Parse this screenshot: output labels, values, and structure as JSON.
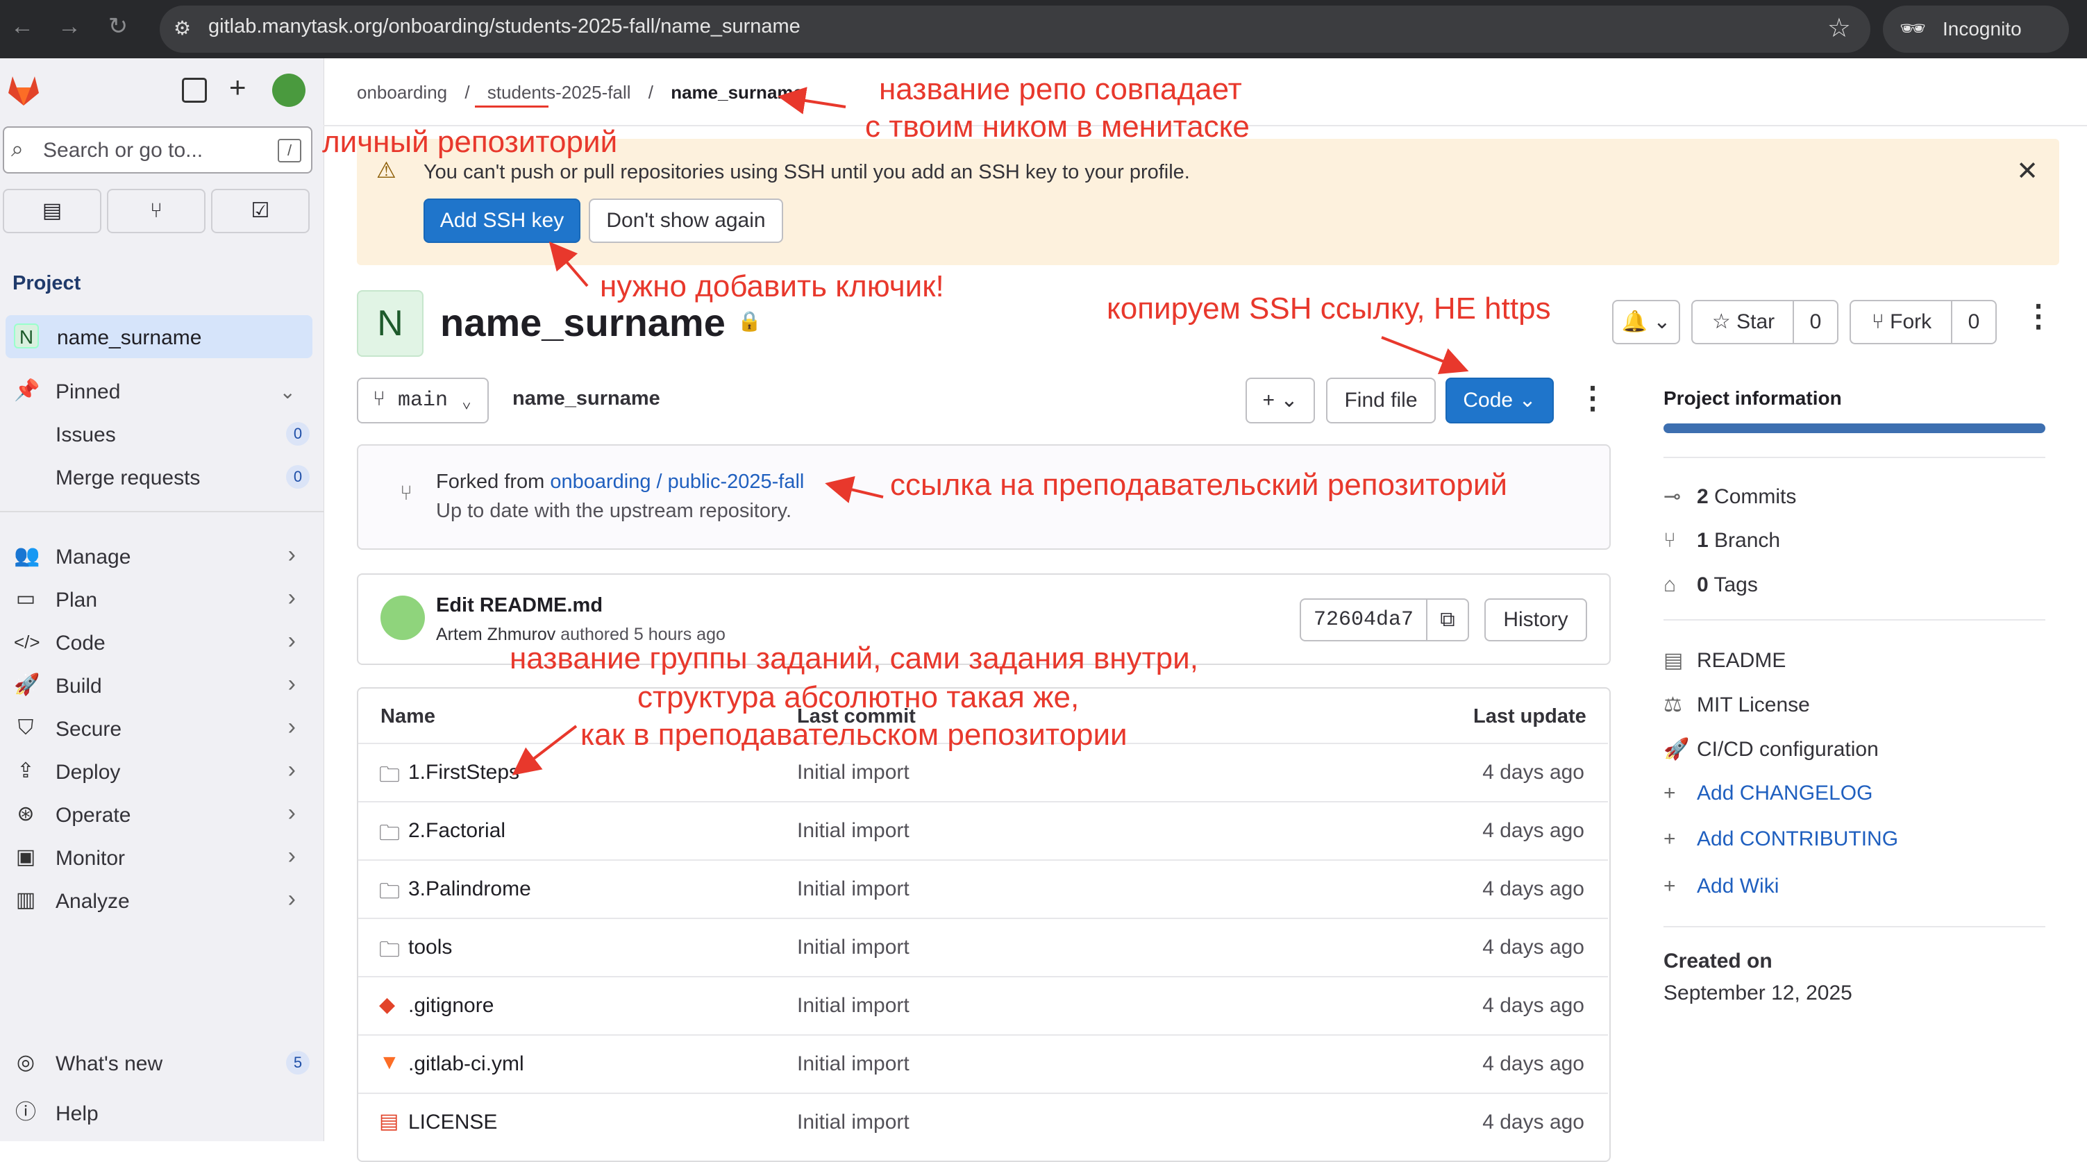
{
  "browser": {
    "url": "gitlab.manytask.org/onboarding/students-2025-fall/name_surname",
    "incognito_label": "Incognito"
  },
  "sidebar": {
    "search_placeholder": "Search or go to...",
    "search_shortcut": "/",
    "section_title": "Project",
    "project_avatar": "N",
    "project_name": "name_surname",
    "pinned_label": "Pinned",
    "pinned_items": [
      {
        "label": "Issues",
        "count": "0"
      },
      {
        "label": "Merge requests",
        "count": "0"
      }
    ],
    "nav": [
      {
        "label": "Manage",
        "icon": "manage-icon"
      },
      {
        "label": "Plan",
        "icon": "plan-icon"
      },
      {
        "label": "Code",
        "icon": "code-icon"
      },
      {
        "label": "Build",
        "icon": "rocket-icon"
      },
      {
        "label": "Secure",
        "icon": "shield-icon"
      },
      {
        "label": "Deploy",
        "icon": "deploy-icon"
      },
      {
        "label": "Operate",
        "icon": "operate-icon"
      },
      {
        "label": "Monitor",
        "icon": "monitor-icon"
      },
      {
        "label": "Analyze",
        "icon": "chart-icon"
      }
    ],
    "whats_new": {
      "label": "What's new",
      "count": "5"
    },
    "help_label": "Help"
  },
  "breadcrumb": [
    "onboarding",
    "students-2025-fall",
    "name_surname"
  ],
  "alert": {
    "text": "You can't push or pull repositories using SSH until you add an SSH key to your profile.",
    "primary_button": "Add SSH key",
    "secondary_button": "Don't show again"
  },
  "project": {
    "avatar": "N",
    "title": "name_surname",
    "star_label": "Star",
    "star_count": "0",
    "fork_label": "Fork",
    "fork_count": "0"
  },
  "toolbar": {
    "branch": "main",
    "path": "name_surname",
    "find_file": "Find file",
    "code_button": "Code"
  },
  "fork_info": {
    "prefix": "Forked from ",
    "source": "onboarding / public-2025-fall",
    "status": "Up to date with the upstream repository."
  },
  "last_commit": {
    "title": "Edit README.md",
    "author": "Artem Zhmurov",
    "meta": " authored 5 hours ago",
    "sha": "72604da7",
    "history_button": "History"
  },
  "file_table": {
    "headers": {
      "name": "Name",
      "commit": "Last commit",
      "update": "Last update"
    },
    "rows": [
      {
        "name": "1.FirstSteps",
        "type": "folder",
        "commit": "Initial import",
        "update": "4 days ago"
      },
      {
        "name": "2.Factorial",
        "type": "folder",
        "commit": "Initial import",
        "update": "4 days ago"
      },
      {
        "name": "3.Palindrome",
        "type": "folder",
        "commit": "Initial import",
        "update": "4 days ago"
      },
      {
        "name": "tools",
        "type": "folder",
        "commit": "Initial import",
        "update": "4 days ago"
      },
      {
        "name": ".gitignore",
        "type": "git",
        "commit": "Initial import",
        "update": "4 days ago"
      },
      {
        "name": ".gitlab-ci.yml",
        "type": "gitlab",
        "commit": "Initial import",
        "update": "4 days ago"
      },
      {
        "name": "LICENSE",
        "type": "license",
        "commit": "Initial import",
        "update": "4 days ago"
      }
    ]
  },
  "project_info": {
    "title": "Project information",
    "commits_count": "2",
    "commits_label": " Commits",
    "branch_count": "1",
    "branch_label": " Branch",
    "tags_count": "0",
    "tags_label": " Tags",
    "readme": "README",
    "license": "MIT License",
    "cicd": "CI/CD configuration",
    "add_changelog": "Add CHANGELOG",
    "add_contributing": "Add CONTRIBUTING",
    "add_wiki": "Add Wiki",
    "created_label": "Created on",
    "created_date": "September 12, 2025"
  },
  "annotations": {
    "repo_name_1": "название репо совпадает",
    "repo_name_2": "с твоим ником в менитаске",
    "personal_repo": "личный репозиторий",
    "add_key": "нужно добавить ключик!",
    "copy_ssh": "копируем SSH ссылку, НЕ https",
    "teacher_link": "ссылка на преподавательский репозиторий",
    "group_1": "название группы заданий, сами задания внутри,",
    "group_2": "структура абсолютно такая же,",
    "group_3": "как в преподавательском репозитории"
  },
  "colors": {
    "primary": "#1f75cb",
    "annotation": "#e8382c",
    "alert_bg": "#fdf1dd"
  }
}
